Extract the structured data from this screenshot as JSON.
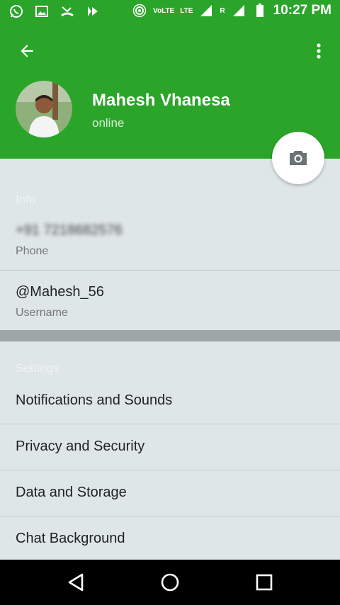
{
  "status_bar": {
    "network_label": "VoLTE",
    "lte_label": "LTE",
    "roaming_label": "R",
    "time": "10:27 PM",
    "icons": [
      "whatsapp-icon",
      "gallery-icon",
      "missed-call-icon",
      "notification-icon",
      "hotspot-icon",
      "signal-icon",
      "battery-icon"
    ]
  },
  "header": {
    "name": "Mahesh Vhanesa",
    "status": "online",
    "accent_color": "#2aa52a"
  },
  "info": {
    "section_title": "Info",
    "phone_value": "+91 7218682576",
    "phone_label": "Phone",
    "username_value": "@Mahesh_56",
    "username_label": "Username"
  },
  "settings": {
    "section_title": "Settings",
    "items": [
      {
        "label": "Notifications and Sounds"
      },
      {
        "label": "Privacy and Security"
      },
      {
        "label": "Data and Storage"
      },
      {
        "label": "Chat Background"
      }
    ]
  }
}
